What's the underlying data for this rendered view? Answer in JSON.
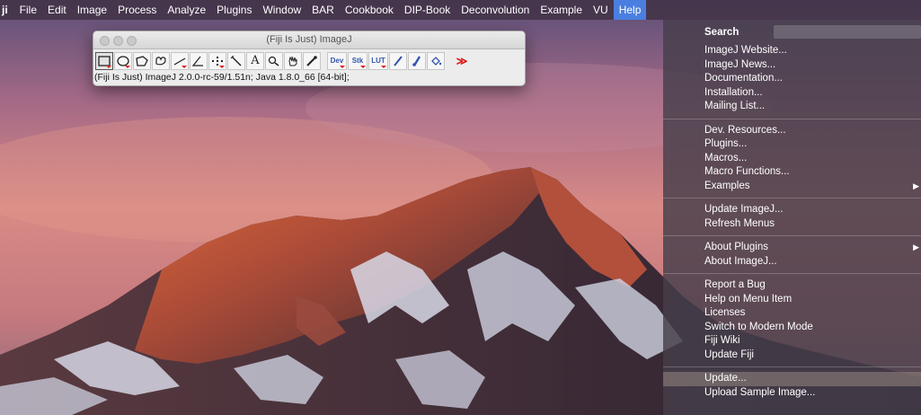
{
  "menubar": {
    "app": "ji",
    "items": [
      "File",
      "Edit",
      "Image",
      "Process",
      "Analyze",
      "Plugins",
      "Window",
      "BAR",
      "Cookbook",
      "DIP-Book",
      "Deconvolution",
      "Example",
      "VU"
    ],
    "active": "Help"
  },
  "imagej": {
    "title": "(Fiji Is Just) ImageJ",
    "status": "(Fiji Is Just) ImageJ 2.0.0-rc-59/1.51n; Java 1.8.0_66 [64-bit];",
    "tools": {
      "dev": "Dev",
      "stk": "Stk",
      "lut": "LUT",
      "text": "A",
      "more": "≫"
    }
  },
  "help_menu": {
    "search_label": "Search",
    "groups": [
      [
        "ImageJ Website...",
        "ImageJ News...",
        "Documentation...",
        "Installation...",
        "Mailing List..."
      ],
      [
        "Dev. Resources...",
        "Plugins...",
        "Macros...",
        "Macro Functions...",
        "Examples"
      ],
      [
        "Update ImageJ...",
        "Refresh Menus"
      ],
      [
        "About Plugins",
        "About ImageJ..."
      ],
      [
        "Report a Bug",
        "Help on Menu Item",
        "Licenses",
        "Switch to Modern Mode",
        "Fiji Wiki",
        "Update Fiji"
      ],
      [
        "Update...",
        "Upload Sample Image..."
      ]
    ],
    "submenu_items": [
      "Examples",
      "About Plugins"
    ],
    "highlighted": "Update...",
    "arrow_glyph": "▶"
  }
}
